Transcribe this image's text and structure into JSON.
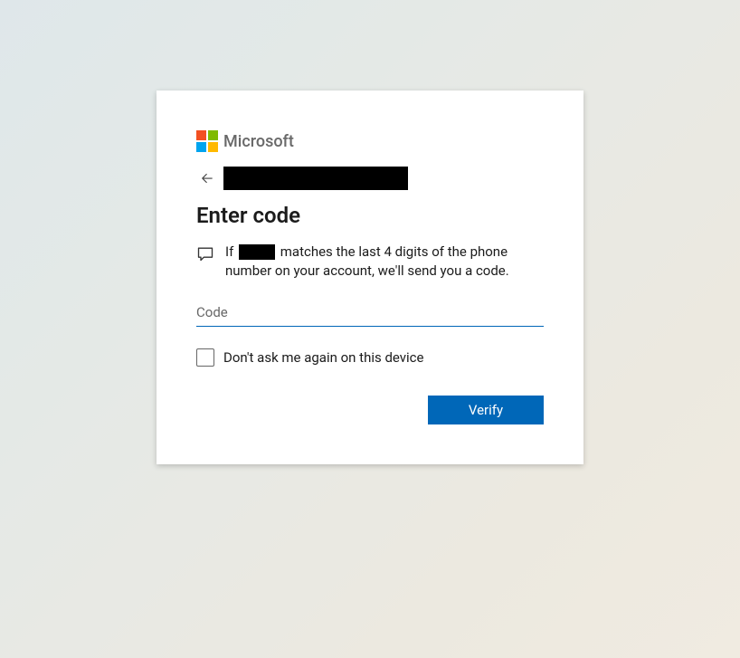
{
  "brand": {
    "name": "Microsoft",
    "colors": {
      "q1": "#f25022",
      "q2": "#7fba00",
      "q3": "#00a4ef",
      "q4": "#ffb900"
    }
  },
  "heading": "Enter code",
  "info": {
    "prefix": "If",
    "suffix": "matches the last 4 digits of the phone number on your account, we'll send you a code."
  },
  "code_input": {
    "placeholder": "Code",
    "value": ""
  },
  "checkbox": {
    "label": "Don't ask me again on this device",
    "checked": false
  },
  "buttons": {
    "verify": "Verify"
  },
  "colors": {
    "accent": "#0067b8"
  }
}
